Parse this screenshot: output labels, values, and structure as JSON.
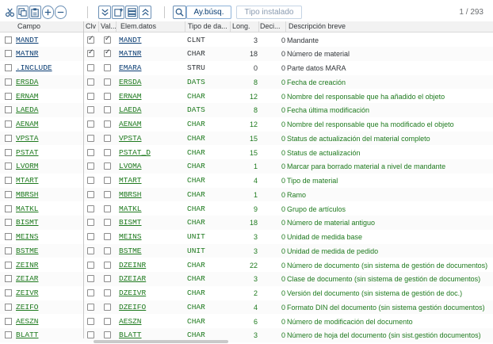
{
  "toolbar": {
    "search_help_label": "Ay.búsq.",
    "installed_type_label": "Tipo instalado",
    "pager_current": "1",
    "pager_separator": "/",
    "pager_total": "293"
  },
  "columns": {
    "campo": "Campo",
    "clv": "Clv",
    "val": "Val...",
    "elem": "Elem.datos",
    "tipo": "Tipo de da...",
    "long": "Long.",
    "deci": "Deci...",
    "desc": "Descripción breve"
  },
  "rows": [
    {
      "campo": "MANDT",
      "clv": true,
      "val": true,
      "elem": "MANDT",
      "tipo": "CLNT",
      "long": "3",
      "deci": "0",
      "desc": "Mandante",
      "color": "dark"
    },
    {
      "campo": "MATNR",
      "clv": true,
      "val": true,
      "elem": "MATNR",
      "tipo": "CHAR",
      "long": "18",
      "deci": "0",
      "desc": "Número de material",
      "color": "dark"
    },
    {
      "campo": ".INCLUDE",
      "clv": false,
      "val": false,
      "elem": "EMARA",
      "tipo": "STRU",
      "long": "0",
      "deci": "0",
      "desc": "Parte datos MARA",
      "color": "dark"
    },
    {
      "campo": "ERSDA",
      "clv": false,
      "val": false,
      "elem": "ERSDA",
      "tipo": "DATS",
      "long": "8",
      "deci": "0",
      "desc": "Fecha de creación",
      "color": "green"
    },
    {
      "campo": "ERNAM",
      "clv": false,
      "val": false,
      "elem": "ERNAM",
      "tipo": "CHAR",
      "long": "12",
      "deci": "0",
      "desc": "Nombre del responsable que ha añadido el objeto",
      "color": "green"
    },
    {
      "campo": "LAEDA",
      "clv": false,
      "val": false,
      "elem": "LAEDA",
      "tipo": "DATS",
      "long": "8",
      "deci": "0",
      "desc": "Fecha última modificación",
      "color": "green"
    },
    {
      "campo": "AENAM",
      "clv": false,
      "val": false,
      "elem": "AENAM",
      "tipo": "CHAR",
      "long": "12",
      "deci": "0",
      "desc": "Nombre del responsable que ha modificado el objeto",
      "color": "green"
    },
    {
      "campo": "VPSTA",
      "clv": false,
      "val": false,
      "elem": "VPSTA",
      "tipo": "CHAR",
      "long": "15",
      "deci": "0",
      "desc": "Status de actualización del material completo",
      "color": "green"
    },
    {
      "campo": "PSTAT",
      "clv": false,
      "val": false,
      "elem": "PSTAT_D",
      "tipo": "CHAR",
      "long": "15",
      "deci": "0",
      "desc": "Status de actualización",
      "color": "green"
    },
    {
      "campo": "LVORM",
      "clv": false,
      "val": false,
      "elem": "LVOMA",
      "tipo": "CHAR",
      "long": "1",
      "deci": "0",
      "desc": "Marcar para borrado material a nivel de mandante",
      "color": "green"
    },
    {
      "campo": "MTART",
      "clv": false,
      "val": false,
      "elem": "MTART",
      "tipo": "CHAR",
      "long": "4",
      "deci": "0",
      "desc": "Tipo de material",
      "color": "green"
    },
    {
      "campo": "MBRSH",
      "clv": false,
      "val": false,
      "elem": "MBRSH",
      "tipo": "CHAR",
      "long": "1",
      "deci": "0",
      "desc": "Ramo",
      "color": "green"
    },
    {
      "campo": "MATKL",
      "clv": false,
      "val": false,
      "elem": "MATKL",
      "tipo": "CHAR",
      "long": "9",
      "deci": "0",
      "desc": "Grupo de artículos",
      "color": "green"
    },
    {
      "campo": "BISMT",
      "clv": false,
      "val": false,
      "elem": "BISMT",
      "tipo": "CHAR",
      "long": "18",
      "deci": "0",
      "desc": "Número de material antiguo",
      "color": "green"
    },
    {
      "campo": "MEINS",
      "clv": false,
      "val": false,
      "elem": "MEINS",
      "tipo": "UNIT",
      "long": "3",
      "deci": "0",
      "desc": "Unidad de medida base",
      "color": "green"
    },
    {
      "campo": "BSTME",
      "clv": false,
      "val": false,
      "elem": "BSTME",
      "tipo": "UNIT",
      "long": "3",
      "deci": "0",
      "desc": "Unidad de medida de pedido",
      "color": "green"
    },
    {
      "campo": "ZEINR",
      "clv": false,
      "val": false,
      "elem": "DZEINR",
      "tipo": "CHAR",
      "long": "22",
      "deci": "0",
      "desc": "Número de documento (sin sistema de gestión de documentos)",
      "color": "green"
    },
    {
      "campo": "ZEIAR",
      "clv": false,
      "val": false,
      "elem": "DZEIAR",
      "tipo": "CHAR",
      "long": "3",
      "deci": "0",
      "desc": "Clase de documento (sin sistema de gestión de documentos)",
      "color": "green"
    },
    {
      "campo": "ZEIVR",
      "clv": false,
      "val": false,
      "elem": "DZEIVR",
      "tipo": "CHAR",
      "long": "2",
      "deci": "0",
      "desc": "Versión del documento (sin sistema de gestión de doc.)",
      "color": "green"
    },
    {
      "campo": "ZEIFO",
      "clv": false,
      "val": false,
      "elem": "DZEIFO",
      "tipo": "CHAR",
      "long": "4",
      "deci": "0",
      "desc": "Formato DIN del documento (sin sistema gestión documentos)",
      "color": "green"
    },
    {
      "campo": "AESZN",
      "clv": false,
      "val": false,
      "elem": "AESZN",
      "tipo": "CHAR",
      "long": "6",
      "deci": "0",
      "desc": "Número de modificación del documento",
      "color": "green"
    },
    {
      "campo": "BLATT",
      "clv": false,
      "val": false,
      "elem": "BLATT",
      "tipo": "CHAR",
      "long": "3",
      "deci": "0",
      "desc": "Número de hoja del documento (sin sist.gestión documentos)",
      "color": "green"
    }
  ]
}
